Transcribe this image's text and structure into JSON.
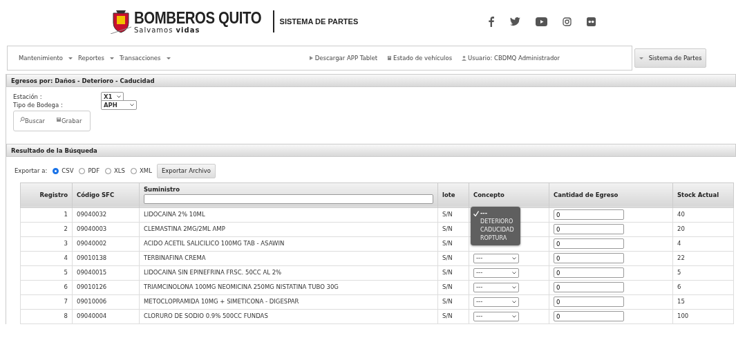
{
  "header": {
    "brand": "BOMBEROS QUITO",
    "slogan": "Salvamos **vidas**",
    "subtitle": "SISTEMA DE PARTES"
  },
  "nav": {
    "menus": [
      {
        "label": "Mantenimiento"
      },
      {
        "label": "Reportes"
      },
      {
        "label": "Transacciones"
      }
    ],
    "links": [
      {
        "kind": "download",
        "label": "Descargar APP Tablet"
      },
      {
        "kind": "vehicle",
        "label": "Estado de vehículos"
      },
      {
        "kind": "user",
        "label": "Usuario: CBDMQ Administrador"
      }
    ],
    "side_button": "Sistema de Partes"
  },
  "filter_panel": {
    "title": "Egresos por: Daños - Deterioro - Caducidad",
    "fields": [
      {
        "label": "Estación :",
        "value": "X1"
      },
      {
        "label": "Tipo de Bodega :",
        "value": "APH"
      }
    ],
    "buttons": [
      {
        "kind": "search",
        "label": "Buscar"
      },
      {
        "kind": "save",
        "label": "Grabar"
      }
    ]
  },
  "results_panel": {
    "title": "Resultado de la Búsqueda",
    "export_label": "Exportar a:",
    "formats": [
      {
        "label": "CSV",
        "selected": true
      },
      {
        "label": "PDF",
        "selected": false
      },
      {
        "label": "XLS",
        "selected": false
      },
      {
        "label": "XML",
        "selected": false
      }
    ],
    "export_button": "Exportar Archivo",
    "table": {
      "columns": [
        "Registro",
        "Código SFC",
        "Suministro",
        "lote",
        "Concepto",
        "Cantidad de Egreso",
        "Stock Actual"
      ],
      "rows": [
        {
          "registro": "1",
          "codigo": "09040032",
          "suministro": "LIDOCAINA 2% 10ML",
          "lote": "S/N",
          "cantidad": "0",
          "stock": "40",
          "concept_menu": {
            "options": [
              {
                "label": "---",
                "selected": true
              },
              {
                "label": "DETERIORO",
                "selected": false
              },
              {
                "label": "CADUCIDAD",
                "selected": false
              },
              {
                "label": "ROPTURA",
                "selected": false
              }
            ]
          }
        },
        {
          "registro": "2",
          "codigo": "09040003",
          "suministro": "CLEMASTINA 2MG/2ML AMP",
          "lote": "S/N",
          "cantidad": "0",
          "stock": "20"
        },
        {
          "registro": "3",
          "codigo": "09040002",
          "suministro": "ACIDO ACETIL SALICILICO 100MG TAB - ASAWIN",
          "lote": "S/N",
          "cantidad": "0",
          "stock": "4"
        },
        {
          "registro": "4",
          "codigo": "09010138",
          "suministro": "TERBINAFINA CREMA",
          "lote": "S/N",
          "concepto": "---",
          "cantidad": "0",
          "stock": "22"
        },
        {
          "registro": "5",
          "codigo": "09040015",
          "suministro": "LIDOCAINA SIN EPINEFRINA FRSC. 50CC AL 2%",
          "lote": "S/N",
          "concepto": "---",
          "cantidad": "0",
          "stock": "5"
        },
        {
          "registro": "6",
          "codigo": "09010126",
          "suministro": "TRIAMCINOLONA 100MG NEOMICINA 250MG NISTATINA TUBO 30G",
          "lote": "S/N",
          "concepto": "---",
          "cantidad": "0",
          "stock": "6"
        },
        {
          "registro": "7",
          "codigo": "09010006",
          "suministro": "METOCLOPRAMIDA 10MG + SIMETICONA - DIGESPAR",
          "lote": "S/N",
          "concepto": "---",
          "cantidad": "0",
          "stock": "15"
        },
        {
          "registro": "8",
          "codigo": "09040004",
          "suministro": "CLORURO DE SODIO 0.9% 500CC FUNDAS",
          "lote": "S/N",
          "concepto": "---",
          "cantidad": "0",
          "stock": "100"
        }
      ]
    }
  }
}
